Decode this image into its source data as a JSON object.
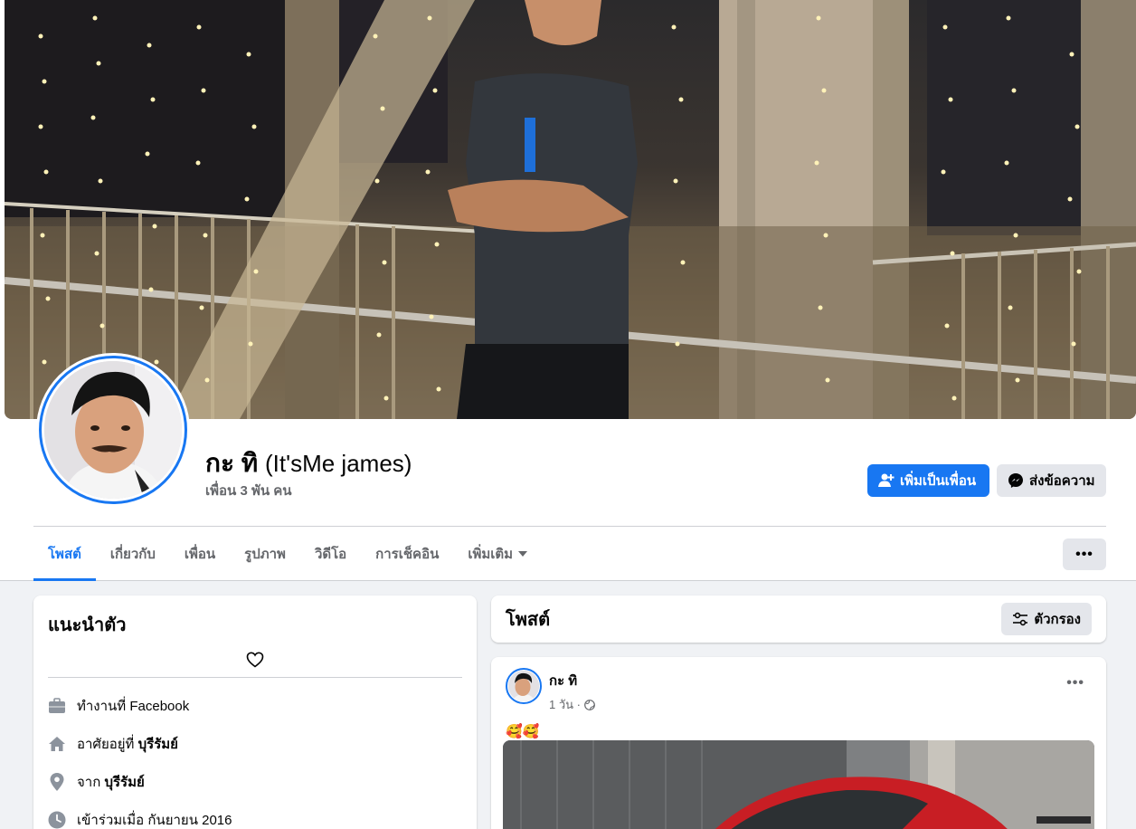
{
  "profile": {
    "name": "กะ ทิ",
    "alt_name": "(It'sMe james)",
    "friends": "เพื่อน 3 พัน คน"
  },
  "actions": {
    "add_friend": "เพิ่มเป็นเพื่อน",
    "message": "ส่งข้อความ"
  },
  "tabs": [
    {
      "label": "โพสต์",
      "active": true
    },
    {
      "label": "เกี่ยวกับ"
    },
    {
      "label": "เพื่อน"
    },
    {
      "label": "รูปภาพ"
    },
    {
      "label": "วิดีโอ"
    },
    {
      "label": "การเช็คอิน"
    },
    {
      "label": "เพิ่มเติม"
    }
  ],
  "more_menu": "•••",
  "intro": {
    "title": "แนะนำตัว",
    "rows": [
      {
        "icon": "briefcase-icon",
        "prefix": "ทำงานที่ Facebook",
        "bold": ""
      },
      {
        "icon": "home-icon",
        "prefix": "อาศัยอยู่ที่ ",
        "bold": "บุรีรัมย์"
      },
      {
        "icon": "location-pin-icon",
        "prefix": "จาก ",
        "bold": "บุรีรัมย์"
      },
      {
        "icon": "clock-icon",
        "prefix": "เข้าร่วมเมื่อ กันยายน 2016",
        "bold": ""
      }
    ]
  },
  "posts": {
    "title": "โพสต์",
    "filter_label": "ตัวกรอง"
  },
  "post": {
    "author": "กะ ทิ",
    "time": "1 วัน ·",
    "text": "🥰🥰",
    "menu": "•••"
  },
  "colors": {
    "accent": "#1877f2",
    "background": "#f0f2f5",
    "secondary_button": "#e4e6eb",
    "muted_text": "#65676b"
  }
}
